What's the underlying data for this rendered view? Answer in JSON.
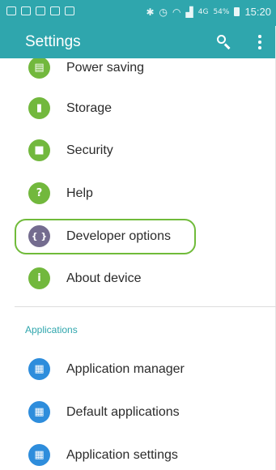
{
  "status_bar": {
    "battery_percent": "54%",
    "network": "4G",
    "time": "15:20"
  },
  "app_bar": {
    "title": "Settings",
    "search_icon": "search-icon",
    "more_icon": "more-vert-icon"
  },
  "settings": {
    "items": [
      {
        "label": "Power saving",
        "icon": "battery-icon"
      },
      {
        "label": "Storage",
        "icon": "sd-card-icon"
      },
      {
        "label": "Security",
        "icon": "lock-icon"
      },
      {
        "label": "Help",
        "icon": "help-icon"
      },
      {
        "label": "Developer options",
        "icon": "braces-icon"
      },
      {
        "label": "About device",
        "icon": "info-icon"
      }
    ]
  },
  "applications": {
    "header": "Applications",
    "items": [
      {
        "label": "Application manager",
        "icon": "grid-icon"
      },
      {
        "label": "Default applications",
        "icon": "grid-check-icon"
      },
      {
        "label": "Application settings",
        "icon": "grid-gear-icon"
      }
    ]
  },
  "colors": {
    "accent": "#2fa6ad",
    "icon_green": "#72b83d",
    "icon_purple": "#746c8f",
    "icon_blue": "#2e8ddc",
    "highlight_green": "#70bb3a"
  }
}
